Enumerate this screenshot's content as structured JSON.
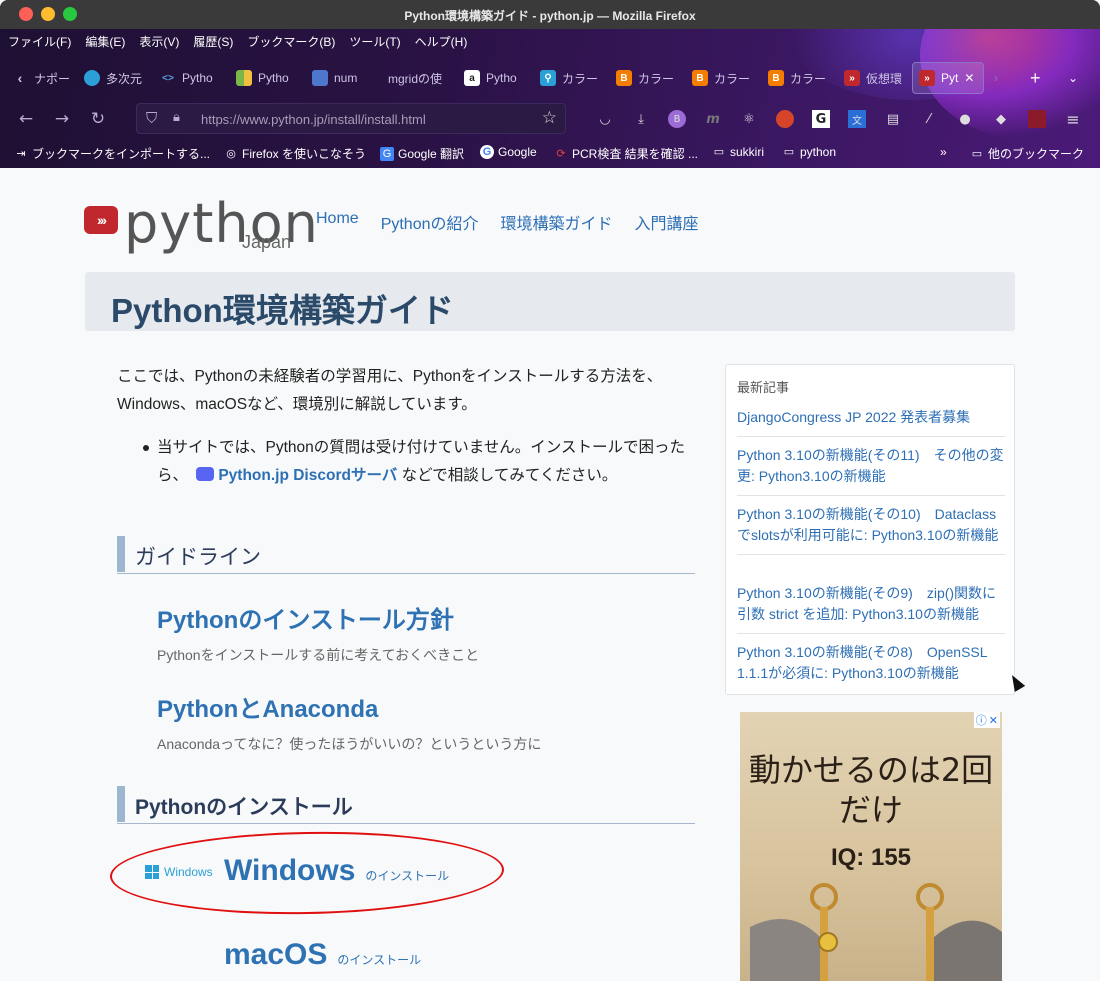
{
  "window": {
    "title": "Python環境構築ガイド - python.jp — Mozilla Firefox"
  },
  "menubar": [
    "ファイル(F)",
    "編集(E)",
    "表示(V)",
    "履歴(S)",
    "ブックマーク(B)",
    "ツール(T)",
    "ヘルプ(H)"
  ],
  "tabs": [
    {
      "label": "ナポー",
      "icon": "back-arrow-icon",
      "color": "#6b5a8c"
    },
    {
      "label": "多次元",
      "icon": "globe-icon",
      "color": "#2aa0d6"
    },
    {
      "label": "Pytho",
      "icon": "code-icon",
      "color": "#5aa0e0"
    },
    {
      "label": "Pytho",
      "icon": "grid-icon",
      "color": "#7ab648"
    },
    {
      "label": "num",
      "icon": "cube-icon",
      "color": "#4d77cf"
    },
    {
      "label": "mgridの使",
      "icon": "",
      "color": "#777"
    },
    {
      "label": "Pytho",
      "icon": "amazon-icon",
      "color": "#fff"
    },
    {
      "label": "カラー",
      "icon": "pin-icon",
      "color": "#2aa0d6"
    },
    {
      "label": "カラー",
      "icon": "blogger-icon",
      "color": "#f57d00"
    },
    {
      "label": "カラー",
      "icon": "blogger-icon",
      "color": "#f57d00"
    },
    {
      "label": "カラー",
      "icon": "blogger-icon",
      "color": "#f57d00"
    },
    {
      "label": "仮想環",
      "icon": "python-jp-icon",
      "color": "#c0282d"
    },
    {
      "label": "Pyt",
      "icon": "python-jp-icon",
      "color": "#c0282d",
      "active": true
    }
  ],
  "url": "https://www.python.jp/install/install.html",
  "bookmarks": [
    {
      "label": "ブックマークをインポートする...",
      "icon": "import-icon"
    },
    {
      "label": "Firefox を使いこなそう",
      "icon": "globe-icon"
    },
    {
      "label": "Google 翻訳",
      "icon": "translate-icon"
    },
    {
      "label": "Google",
      "icon": "google-icon"
    },
    {
      "label": "PCR検査 結果を確認 ...",
      "icon": "link-icon"
    },
    {
      "label": "sukkiri",
      "icon": "folder-icon"
    },
    {
      "label": "python",
      "icon": "folder-icon"
    }
  ],
  "bookmarks_other": "他のブックマーク",
  "site": {
    "logo_word": "python",
    "logo_sub": "Japan",
    "nav": [
      "Home",
      "Pythonの紹介",
      "環境構築ガイド",
      "入門講座"
    ],
    "page_title": "Python環境構築ガイド",
    "intro": "ここでは、Pythonの未経験者の学習用に、Pythonをインストールする方法を、Windows、macOSなど、環境別に解説しています。",
    "bullet_pre": "当サイトでは、Pythonの質問は受け付けていません。インストールで困ったら、",
    "bullet_link": "Python.jp Discordサーバ",
    "bullet_post": "などで相談してみてください。",
    "section_guideline": "ガイドライン",
    "guides": [
      {
        "title": "Pythonのインストール方針",
        "sub": "Pythonをインストールする前に考えておくべきこと"
      },
      {
        "title": "PythonとAnaconda",
        "sub": "Anacondaってなに？使ったほうがいいの？というという方に"
      }
    ],
    "section_install": "Pythonのインストール",
    "windows_logo": "Windows",
    "windows_title": "Windows",
    "windows_sub": "のインストール",
    "macos_title": "macOS",
    "macos_sub": "のインストール"
  },
  "sidebar": {
    "heading": "最新記事",
    "items": [
      "DjangoCongress JP 2022 発表者募集",
      "Python 3.10の新機能(その11)　その他の変更: Python3.10の新機能",
      "Python 3.10の新機能(その10)　Dataclassでslotsが利用可能に: Python3.10の新機能",
      "Python 3.10の新機能(その9)　zip()関数に引数 strict を追加: Python3.10の新機能",
      "Python 3.10の新機能(その8)　OpenSSL 1.1.1が必須に: Python3.10の新機能"
    ]
  },
  "ad": {
    "text": "動かせるのは2回だけ",
    "iq": "IQ: 155",
    "info_icon": "info-icon",
    "close_icon": "close-icon"
  }
}
